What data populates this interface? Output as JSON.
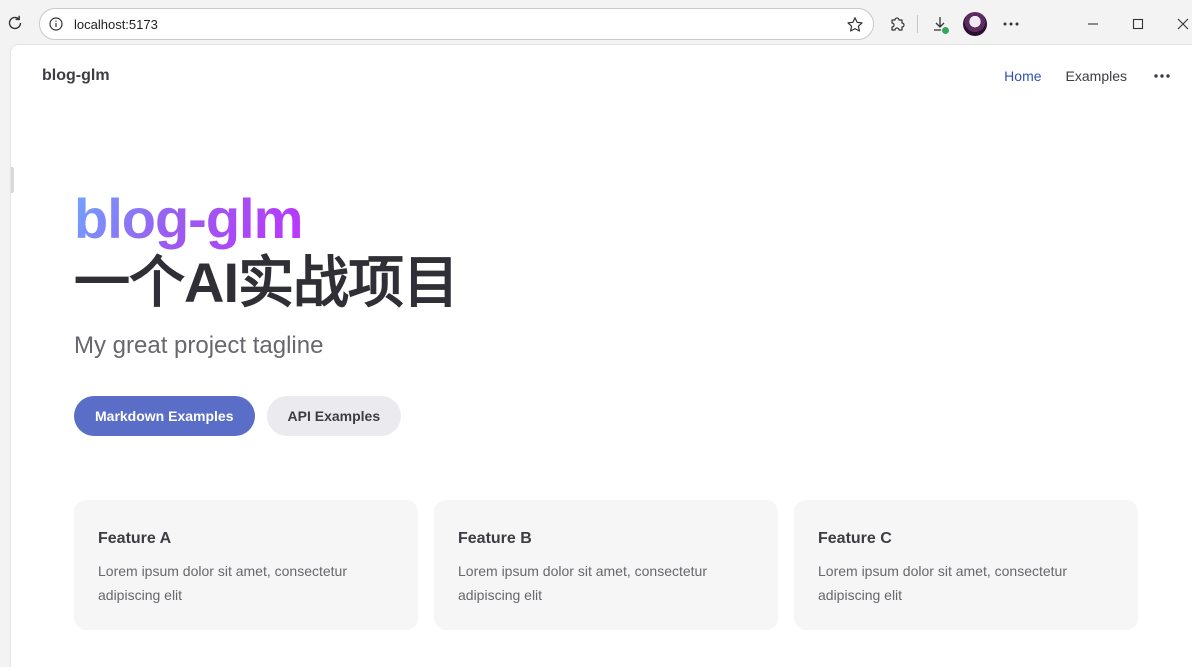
{
  "browser": {
    "url": "localhost:5173"
  },
  "nav": {
    "site_title": "blog-glm",
    "links": [
      {
        "label": "Home",
        "active": true
      },
      {
        "label": "Examples",
        "active": false
      }
    ]
  },
  "hero": {
    "name": "blog-glm",
    "text": "一个AI实战项目",
    "tagline": "My great project tagline",
    "actions": [
      {
        "label": "Markdown Examples",
        "theme": "brand"
      },
      {
        "label": "API Examples",
        "theme": "alt"
      }
    ]
  },
  "features": [
    {
      "title": "Feature A",
      "details": "Lorem ipsum dolor sit amet, consectetur adipiscing elit"
    },
    {
      "title": "Feature B",
      "details": "Lorem ipsum dolor sit amet, consectetur adipiscing elit"
    },
    {
      "title": "Feature C",
      "details": "Lorem ipsum dolor sit amet, consectetur adipiscing elit"
    }
  ],
  "colors": {
    "brand": "#5b6ec7",
    "nav_active": "#3451b2",
    "gradient_start": "#6ea7ff",
    "gradient_end": "#bd34fe"
  },
  "icons": {
    "reload": "reload-icon",
    "info": "info-icon",
    "star": "bookmark-star-icon",
    "extensions": "extensions-puzzle-icon",
    "downloads": "download-icon",
    "menu": "more-horizontal-icon",
    "minimize": "minimize-icon",
    "maximize": "maximize-icon",
    "close": "close-icon"
  }
}
